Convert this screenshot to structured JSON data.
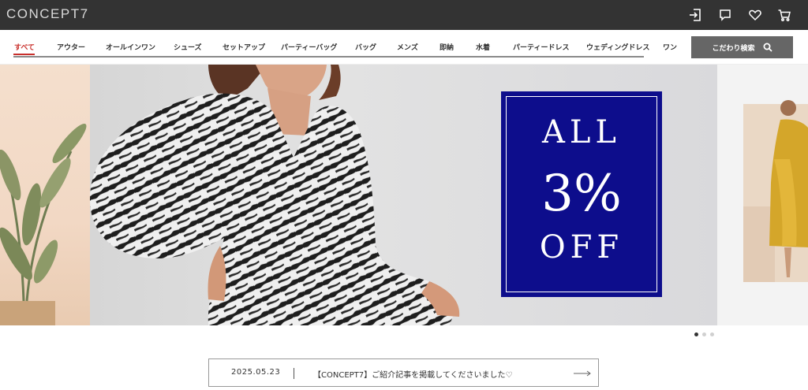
{
  "header": {
    "logo": "CONCEPT7",
    "icons": [
      "login-icon",
      "chat-icon",
      "heart-icon",
      "cart-icon"
    ]
  },
  "nav": {
    "categories": [
      "すべて",
      "アウター",
      "オールインワン",
      "シューズ",
      "セットアップ",
      "パーティーバッグ",
      "バッグ",
      "メンズ",
      "即納",
      "水着",
      "パーティードレス",
      "ウェディングドレス",
      "ワン"
    ],
    "active_index": 0,
    "search_label": "こだわり検索"
  },
  "banner": {
    "promo_line1": "ALL",
    "promo_line2": "3%",
    "promo_line3": "OFF",
    "dots": 3,
    "active_dot": 0
  },
  "news": {
    "date": "2025.05.23",
    "text": "【CONCEPT7】ご紹介記事を掲載してくださいました♡"
  },
  "colors": {
    "topbar": "#333333",
    "accent": "#c9302c",
    "promo_blue": "#0d0d8c",
    "search_button": "#666666"
  }
}
